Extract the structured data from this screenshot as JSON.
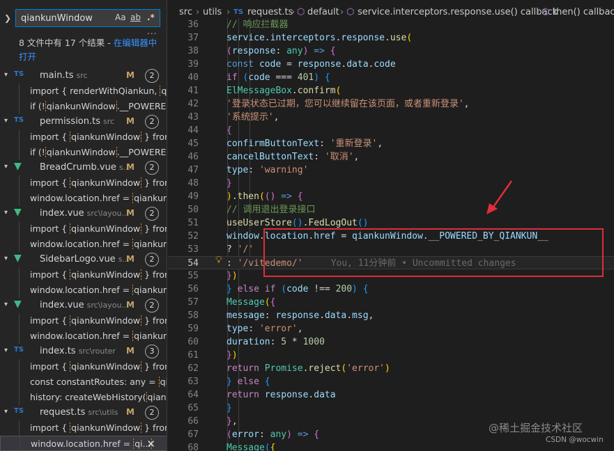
{
  "search": {
    "query": "qiankunWindow",
    "opt_case": "Aa",
    "opt_word": "ab",
    "opt_regex": ".*",
    "more": "...",
    "summary": "8 文件中有 17 个结果 - ",
    "summary_link": "在编辑器中打开"
  },
  "results": [
    {
      "name": "main.ts",
      "path": "src",
      "kind": "ts",
      "badge": "M",
      "count": "2",
      "matches": [
        {
          "pre": "import { renderWithQiankun, ",
          "hit": "qia",
          "post": ""
        },
        {
          "pre": "if (!",
          "hit": "qiankunWindow",
          "post": ".__POWERED_BY"
        }
      ]
    },
    {
      "name": "permission.ts",
      "path": "src",
      "kind": "ts",
      "badge": "M",
      "count": "2",
      "matches": [
        {
          "pre": "import { ",
          "hit": "qiankunWindow",
          "post": " } from ..."
        },
        {
          "pre": "if (!",
          "hit": "qiankunWindow",
          "post": ".__POWERED_BY"
        }
      ]
    },
    {
      "name": "BreadCrumb.vue",
      "path": "s...",
      "kind": "vue",
      "badge": "M",
      "count": "2",
      "matches": [
        {
          "pre": "import { ",
          "hit": "qiankunWindow",
          "post": " } from ..."
        },
        {
          "pre": "window.location.href = ",
          "hit": "qiankunWi",
          "post": ""
        }
      ]
    },
    {
      "name": "index.vue",
      "path": "src\\layou...",
      "kind": "vue",
      "badge": "M",
      "count": "2",
      "matches": [
        {
          "pre": "import { ",
          "hit": "qiankunWindow",
          "post": " } from ..."
        },
        {
          "pre": "window.location.href = ",
          "hit": "qiankunWi",
          "post": ""
        }
      ]
    },
    {
      "name": "SidebarLogo.vue",
      "path": "s...",
      "kind": "vue",
      "badge": "M",
      "count": "2",
      "matches": [
        {
          "pre": "import { ",
          "hit": "qiankunWindow",
          "post": " } from ..."
        },
        {
          "pre": "window.location.href = ",
          "hit": "qiankunWi",
          "post": ""
        }
      ]
    },
    {
      "name": "index.vue",
      "path": "src\\layou...",
      "kind": "vue",
      "badge": "M",
      "count": "2",
      "matches": [
        {
          "pre": "import { ",
          "hit": "qiankunWindow",
          "post": " } from ..."
        },
        {
          "pre": "window.location.href = ",
          "hit": "qiankunWi",
          "post": ""
        }
      ]
    },
    {
      "name": "index.ts",
      "path": "src\\router",
      "kind": "ts",
      "badge": "M",
      "count": "3",
      "matches": [
        {
          "pre": "import { ",
          "hit": "qiankunWindow",
          "post": " } from ..."
        },
        {
          "pre": "const constantRoutes: any = ",
          "hit": "qia",
          "post": ""
        },
        {
          "pre": "history: createWebHistory(",
          "hit": "qiank",
          "post": ""
        }
      ]
    },
    {
      "name": "request.ts",
      "path": "src\\utils",
      "kind": "ts",
      "badge": "M",
      "count": "2",
      "matches": [
        {
          "pre": "import { ",
          "hit": "qiankunWindow",
          "post": " } from ..."
        },
        {
          "pre": "window.location.href = ",
          "hit": "qi...",
          "post": "",
          "selected": true
        }
      ]
    }
  ],
  "breadcrumb": [
    "src",
    "utils",
    "request.ts",
    "default",
    "service.interceptors.response.use() callback",
    "then() callback"
  ],
  "blame": "You, 11分钟前 • Uncommitted changes",
  "watermark": "@稀土掘金技术社区",
  "watermark2": "CSDN @wocwin",
  "code": [
    {
      "n": "36",
      "t": [
        [
          "cm",
          "    // 响应拦截器"
        ]
      ]
    },
    {
      "n": "37",
      "t": [
        [
          "v",
          "    service"
        ],
        [
          "p",
          "."
        ],
        [
          "v",
          "interceptors"
        ],
        [
          "p",
          "."
        ],
        [
          "v",
          "response"
        ],
        [
          "p",
          "."
        ],
        [
          "f",
          "use"
        ],
        [
          "b1",
          "("
        ]
      ]
    },
    {
      "n": "38",
      "t": [
        [
          "p",
          "      "
        ],
        [
          "b2",
          "("
        ],
        [
          "v",
          "response"
        ],
        [
          "p",
          ": "
        ],
        [
          "t",
          "any"
        ],
        [
          "b2",
          ")"
        ],
        [
          "p",
          " "
        ],
        [
          "k",
          "=>"
        ],
        [
          "p",
          " "
        ],
        [
          "b2",
          "{"
        ]
      ]
    },
    {
      "n": "39",
      "t": [
        [
          "p",
          "        "
        ],
        [
          "k",
          "const"
        ],
        [
          "p",
          " "
        ],
        [
          "v",
          "code"
        ],
        [
          "p",
          " = "
        ],
        [
          "v",
          "response"
        ],
        [
          "p",
          "."
        ],
        [
          "v",
          "data"
        ],
        [
          "p",
          "."
        ],
        [
          "v",
          "code"
        ]
      ]
    },
    {
      "n": "40",
      "t": [
        [
          "p",
          "        "
        ],
        [
          "c",
          "if"
        ],
        [
          "p",
          " "
        ],
        [
          "b3",
          "("
        ],
        [
          "v",
          "code"
        ],
        [
          "p",
          " === "
        ],
        [
          "n",
          "401"
        ],
        [
          "b3",
          ")"
        ],
        [
          "p",
          " "
        ],
        [
          "b3",
          "{"
        ]
      ]
    },
    {
      "n": "41",
      "t": [
        [
          "p",
          "          "
        ],
        [
          "t",
          "ElMessageBox"
        ],
        [
          "p",
          "."
        ],
        [
          "f",
          "confirm"
        ],
        [
          "b1",
          "("
        ]
      ]
    },
    {
      "n": "42",
      "t": [
        [
          "p",
          "            "
        ],
        [
          "s",
          "'登录状态已过期，您可以继续留在该页面，或者重新登录'"
        ],
        [
          "p",
          ","
        ]
      ]
    },
    {
      "n": "43",
      "t": [
        [
          "p",
          "            "
        ],
        [
          "s",
          "'系统提示'"
        ],
        [
          "p",
          ","
        ]
      ]
    },
    {
      "n": "44",
      "t": [
        [
          "p",
          "            "
        ],
        [
          "b2",
          "{"
        ]
      ]
    },
    {
      "n": "45",
      "t": [
        [
          "p",
          "              "
        ],
        [
          "v",
          "confirmButtonText"
        ],
        [
          "p",
          ": "
        ],
        [
          "s",
          "'重新登录'"
        ],
        [
          "p",
          ","
        ]
      ]
    },
    {
      "n": "46",
      "t": [
        [
          "p",
          "              "
        ],
        [
          "v",
          "cancelButtonText"
        ],
        [
          "p",
          ": "
        ],
        [
          "s",
          "'取消'"
        ],
        [
          "p",
          ","
        ]
      ]
    },
    {
      "n": "47",
      "t": [
        [
          "p",
          "              "
        ],
        [
          "v",
          "type"
        ],
        [
          "p",
          ": "
        ],
        [
          "s",
          "'warning'"
        ]
      ]
    },
    {
      "n": "48",
      "t": [
        [
          "p",
          "            "
        ],
        [
          "b2",
          "}"
        ]
      ]
    },
    {
      "n": "49",
      "t": [
        [
          "p",
          "          "
        ],
        [
          "b1",
          ")"
        ],
        [
          "p",
          "."
        ],
        [
          "f",
          "then"
        ],
        [
          "b1",
          "("
        ],
        [
          "b2",
          "()"
        ],
        [
          "p",
          " "
        ],
        [
          "k",
          "=>"
        ],
        [
          "p",
          " "
        ],
        [
          "b2",
          "{"
        ]
      ]
    },
    {
      "n": "50",
      "t": [
        [
          "p",
          "            "
        ],
        [
          "cm",
          "// 调用退出登录接口"
        ]
      ]
    },
    {
      "n": "51",
      "t": [
        [
          "p",
          "            "
        ],
        [
          "f",
          "useUserStore"
        ],
        [
          "b3",
          "()"
        ],
        [
          "p",
          "."
        ],
        [
          "f",
          "FedLogOut"
        ],
        [
          "b3",
          "()"
        ]
      ]
    },
    {
      "n": "52",
      "t": [
        [
          "p",
          "            "
        ],
        [
          "v",
          "window"
        ],
        [
          "p",
          "."
        ],
        [
          "v",
          "location"
        ],
        [
          "p",
          "."
        ],
        [
          "v",
          "href"
        ],
        [
          "p",
          " = "
        ],
        [
          "v",
          "qiankunWindow"
        ],
        [
          "p",
          "."
        ],
        [
          "v",
          "__POWERED_BY_QIANKUN__"
        ]
      ]
    },
    {
      "n": "53",
      "t": [
        [
          "p",
          "              "
        ],
        [
          "p",
          "? "
        ],
        [
          "s",
          "'/'"
        ]
      ]
    },
    {
      "n": "54",
      "t": [
        [
          "p",
          "              "
        ],
        [
          "p",
          ": "
        ],
        [
          "s",
          "'/vitedemo/'"
        ]
      ],
      "blame": true,
      "cur": true
    },
    {
      "n": "55",
      "t": [
        [
          "p",
          "          "
        ],
        [
          "b2",
          "}"
        ],
        [
          "b1",
          ")"
        ]
      ]
    },
    {
      "n": "56",
      "t": [
        [
          "p",
          "        "
        ],
        [
          "b3",
          "}"
        ],
        [
          "p",
          " "
        ],
        [
          "c",
          "else"
        ],
        [
          "p",
          " "
        ],
        [
          "c",
          "if"
        ],
        [
          "p",
          " "
        ],
        [
          "b3",
          "("
        ],
        [
          "v",
          "code"
        ],
        [
          "p",
          " !== "
        ],
        [
          "n",
          "200"
        ],
        [
          "b3",
          ")"
        ],
        [
          "p",
          " "
        ],
        [
          "b3",
          "{"
        ]
      ]
    },
    {
      "n": "57",
      "t": [
        [
          "p",
          "          "
        ],
        [
          "t",
          "Message"
        ],
        [
          "b1",
          "("
        ],
        [
          "b2",
          "{"
        ]
      ]
    },
    {
      "n": "58",
      "t": [
        [
          "p",
          "            "
        ],
        [
          "v",
          "message"
        ],
        [
          "p",
          ": "
        ],
        [
          "v",
          "response"
        ],
        [
          "p",
          "."
        ],
        [
          "v",
          "data"
        ],
        [
          "p",
          "."
        ],
        [
          "v",
          "msg"
        ],
        [
          "p",
          ","
        ]
      ]
    },
    {
      "n": "59",
      "t": [
        [
          "p",
          "            "
        ],
        [
          "v",
          "type"
        ],
        [
          "p",
          ": "
        ],
        [
          "s",
          "'error'"
        ],
        [
          "p",
          ","
        ]
      ]
    },
    {
      "n": "60",
      "t": [
        [
          "p",
          "            "
        ],
        [
          "v",
          "duration"
        ],
        [
          "p",
          ": "
        ],
        [
          "n",
          "5"
        ],
        [
          "p",
          " * "
        ],
        [
          "n",
          "1000"
        ]
      ]
    },
    {
      "n": "61",
      "t": [
        [
          "p",
          "          "
        ],
        [
          "b2",
          "}"
        ],
        [
          "b1",
          ")"
        ]
      ]
    },
    {
      "n": "62",
      "t": [
        [
          "p",
          "          "
        ],
        [
          "c",
          "return"
        ],
        [
          "p",
          " "
        ],
        [
          "t",
          "Promise"
        ],
        [
          "p",
          "."
        ],
        [
          "f",
          "reject"
        ],
        [
          "b1",
          "("
        ],
        [
          "s",
          "'error'"
        ],
        [
          "b1",
          ")"
        ]
      ]
    },
    {
      "n": "63",
      "t": [
        [
          "p",
          "        "
        ],
        [
          "b3",
          "}"
        ],
        [
          "p",
          " "
        ],
        [
          "c",
          "else"
        ],
        [
          "p",
          " "
        ],
        [
          "b3",
          "{"
        ]
      ]
    },
    {
      "n": "64",
      "t": [
        [
          "p",
          "          "
        ],
        [
          "c",
          "return"
        ],
        [
          "p",
          " "
        ],
        [
          "v",
          "response"
        ],
        [
          "p",
          "."
        ],
        [
          "v",
          "data"
        ]
      ]
    },
    {
      "n": "65",
      "t": [
        [
          "p",
          "        "
        ],
        [
          "b3",
          "}"
        ]
      ]
    },
    {
      "n": "66",
      "t": [
        [
          "p",
          "      "
        ],
        [
          "b2",
          "}"
        ],
        [
          "p",
          ","
        ]
      ]
    },
    {
      "n": "67",
      "t": [
        [
          "p",
          "      "
        ],
        [
          "b2",
          "("
        ],
        [
          "v",
          "error"
        ],
        [
          "p",
          ": "
        ],
        [
          "t",
          "any"
        ],
        [
          "b2",
          ")"
        ],
        [
          "p",
          " "
        ],
        [
          "k",
          "=>"
        ],
        [
          "p",
          " "
        ],
        [
          "b2",
          "{"
        ]
      ]
    },
    {
      "n": "68",
      "t": [
        [
          "p",
          "        "
        ],
        [
          "t",
          "Message"
        ],
        [
          "b3",
          "("
        ],
        [
          "b1",
          "{"
        ]
      ]
    }
  ]
}
